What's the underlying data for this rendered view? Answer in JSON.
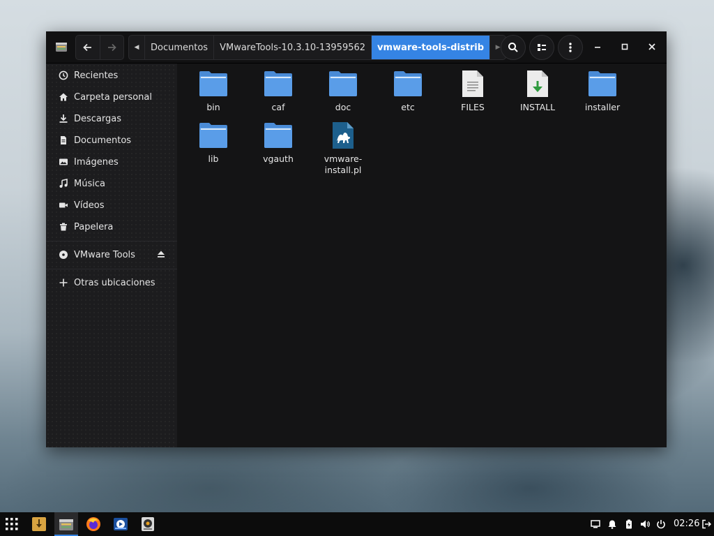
{
  "window": {
    "nav": {
      "back_icon": "arrow-left-icon",
      "forward_icon": "arrow-right-icon"
    },
    "breadcrumbs": [
      "Documentos",
      "VMwareTools-10.3.10-13959562",
      "vmware-tools-distrib"
    ],
    "active_crumb_index": 2,
    "toolbar_icons": [
      "search-icon",
      "view-list-icon",
      "menu-kebab-icon"
    ],
    "controls": [
      "minimize-icon",
      "maximize-icon",
      "close-icon"
    ]
  },
  "sidebar": {
    "places": [
      {
        "label": "Recientes",
        "icon": "clock-icon"
      },
      {
        "label": "Carpeta personal",
        "icon": "home-icon"
      },
      {
        "label": "Descargas",
        "icon": "download-icon"
      },
      {
        "label": "Documentos",
        "icon": "document-icon"
      },
      {
        "label": "Imágenes",
        "icon": "image-icon"
      },
      {
        "label": "Música",
        "icon": "music-icon"
      },
      {
        "label": "Vídeos",
        "icon": "video-icon"
      },
      {
        "label": "Papelera",
        "icon": "trash-icon"
      }
    ],
    "devices": [
      {
        "label": "VMware Tools",
        "icon": "disc-icon",
        "eject_icon": "eject-icon"
      }
    ],
    "other": {
      "label": "Otras ubicaciones",
      "icon": "plus-icon"
    }
  },
  "files": [
    {
      "name": "bin",
      "type": "folder"
    },
    {
      "name": "caf",
      "type": "folder"
    },
    {
      "name": "doc",
      "type": "folder"
    },
    {
      "name": "etc",
      "type": "folder"
    },
    {
      "name": "FILES",
      "type": "text"
    },
    {
      "name": "INSTALL",
      "type": "install"
    },
    {
      "name": "installer",
      "type": "folder"
    },
    {
      "name": "lib",
      "type": "folder"
    },
    {
      "name": "vgauth",
      "type": "folder"
    },
    {
      "name": "vmware-install.pl",
      "display": "vmware-\ninstall.pl",
      "type": "perl"
    }
  ],
  "taskbar": {
    "apps": [
      "app-grid-icon",
      "archive-manager-icon",
      "file-manager-icon",
      "firefox-icon",
      "media-player-icon",
      "disk-utility-icon"
    ],
    "tray": [
      "display-icon",
      "notification-bell-icon",
      "battery-icon",
      "volume-icon",
      "power-icon",
      "logout-icon"
    ],
    "clock": "02:26"
  },
  "colors": {
    "accent": "#3584e4",
    "folder": "#5294e2",
    "window_bg": "#141415",
    "sidebar_bg": "#1c1c1e"
  }
}
